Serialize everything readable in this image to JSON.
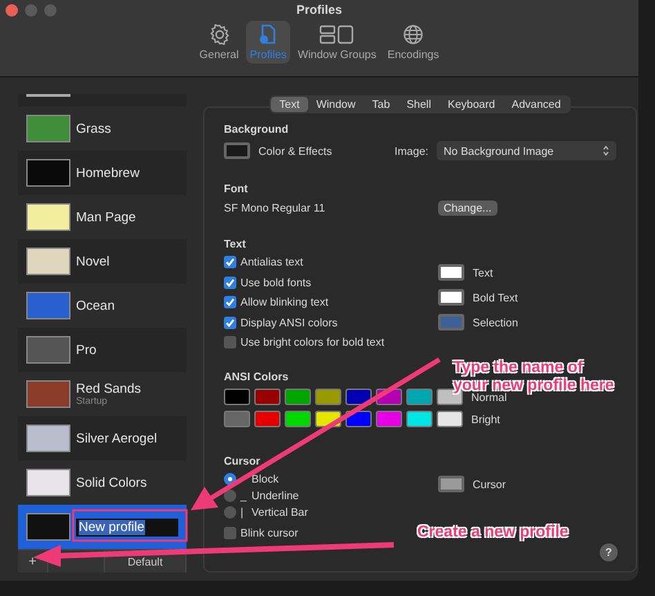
{
  "window": {
    "title": "Profiles"
  },
  "toolbar": [
    {
      "label": "General",
      "kind": "gear",
      "selected": false
    },
    {
      "label": "Profiles",
      "kind": "profile",
      "selected": true
    },
    {
      "label": "Window Groups",
      "kind": "windows",
      "selected": false
    },
    {
      "label": "Encodings",
      "kind": "globe",
      "selected": false
    }
  ],
  "profiles": [
    {
      "name": "Grass",
      "color": "#3f8f3a",
      "selected": false,
      "editing": false
    },
    {
      "name": "Homebrew",
      "color": "#0a0a0a",
      "selected": false,
      "editing": false
    },
    {
      "name": "Man Page",
      "color": "#f2eea0",
      "selected": false,
      "editing": false
    },
    {
      "name": "Novel",
      "color": "#ded6bd",
      "selected": false,
      "editing": false
    },
    {
      "name": "Ocean",
      "color": "#2a5fcf",
      "selected": false,
      "editing": false
    },
    {
      "name": "Pro",
      "color": "#555555",
      "selected": false,
      "editing": false
    },
    {
      "name": "Red Sands",
      "subtitle": "Startup",
      "color": "#8a3b2a",
      "selected": false,
      "editing": false
    },
    {
      "name": "Silver Aerogel",
      "color": "#b8bccb",
      "selected": false,
      "editing": false
    },
    {
      "name": "Solid Colors",
      "color": "#e9e4ea",
      "selected": false,
      "editing": false
    },
    {
      "name": "New profile",
      "color": "#111111",
      "selected": true,
      "editing": true
    }
  ],
  "profile_buttons": [
    "+",
    "Default"
  ],
  "tabs": [
    {
      "label": "Text",
      "selected": true
    },
    {
      "label": "Window",
      "selected": false
    },
    {
      "label": "Tab",
      "selected": false
    },
    {
      "label": "Shell",
      "selected": false
    },
    {
      "label": "Keyboard",
      "selected": false
    },
    {
      "label": "Advanced",
      "selected": false
    }
  ],
  "background": {
    "heading": "Background",
    "well": {
      "label": "Color & Effects",
      "color": "#1a1a1a"
    },
    "image_label": "Image:",
    "image_value": "No Background Image"
  },
  "font": {
    "heading": "Font",
    "value": "SF Mono Regular 11",
    "button": "Change..."
  },
  "text": {
    "heading": "Text",
    "options": [
      {
        "label": "Antialias text",
        "checked": true
      },
      {
        "label": "Use bold fonts",
        "checked": true
      },
      {
        "label": "Allow blinking text",
        "checked": true
      },
      {
        "label": "Display ANSI colors",
        "checked": true
      },
      {
        "label": "Use bright colors for bold text",
        "checked": false
      }
    ],
    "colors": [
      {
        "label": "Text",
        "color": "#ffffff"
      },
      {
        "label": "Bold Text",
        "color": "#ffffff"
      },
      {
        "label": "Selection",
        "color": "#3f5f99"
      }
    ]
  },
  "ansi": {
    "heading": "ANSI Colors",
    "rows": [
      {
        "label": "Normal",
        "swatches": [
          {
            "color": "#000000"
          },
          {
            "color": "#990000"
          },
          {
            "color": "#00a600"
          },
          {
            "color": "#999900"
          },
          {
            "color": "#0000b2"
          },
          {
            "color": "#b200b2"
          },
          {
            "color": "#00a6b2"
          },
          {
            "color": "#bfbfbf"
          }
        ]
      },
      {
        "label": "Bright",
        "swatches": [
          {
            "color": "#666666"
          },
          {
            "color": "#e50000"
          },
          {
            "color": "#00d900"
          },
          {
            "color": "#e5e500"
          },
          {
            "color": "#0000ff"
          },
          {
            "color": "#e500e5"
          },
          {
            "color": "#00e5e5"
          },
          {
            "color": "#e5e5e5"
          }
        ]
      }
    ]
  },
  "cursor": {
    "heading": "Cursor",
    "styles": [
      {
        "label": "Block",
        "selected": true
      },
      {
        "symbol": "_",
        "label": "Underline",
        "selected": false
      },
      {
        "symbol": "|",
        "label": "Vertical Bar",
        "selected": false
      }
    ],
    "blink": {
      "label": "Blink cursor",
      "checked": false
    },
    "color_label": "Cursor",
    "color": "#9a9a9a"
  },
  "help_button": "?",
  "annotations": [
    {
      "lines": [
        "Type the name of",
        "your new profile here"
      ],
      "kind": "field"
    },
    {
      "lines": [
        "Create a new profile"
      ],
      "kind": "add"
    }
  ]
}
